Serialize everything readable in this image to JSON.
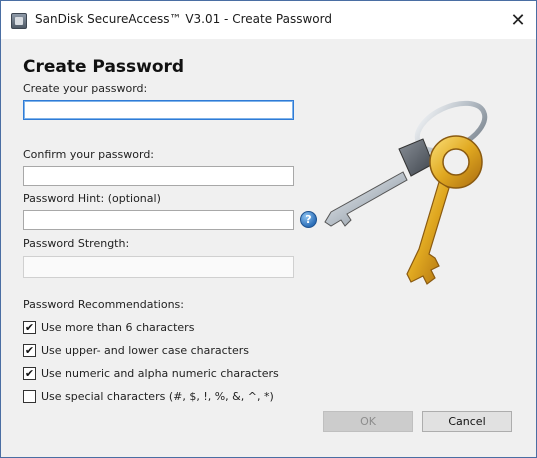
{
  "window": {
    "title": "SanDisk SecureAccess™ V3.01 - Create Password",
    "close_glyph": "✕"
  },
  "form": {
    "heading": "Create Password",
    "create_label": "Create your password:",
    "create_value": "",
    "confirm_label": "Confirm your password:",
    "confirm_value": "",
    "hint_label": "Password Hint: (optional)",
    "hint_value": "",
    "strength_label": "Password Strength:",
    "strength_value": "",
    "help_glyph": "?"
  },
  "recommendations": {
    "label": "Password Recommendations:",
    "items": [
      {
        "label": "Use more than 6 characters",
        "checked": true,
        "mark": "✔"
      },
      {
        "label": "Use upper- and lower case characters",
        "checked": true,
        "mark": "✔"
      },
      {
        "label": "Use numeric and alpha numeric characters",
        "checked": true,
        "mark": "✔"
      },
      {
        "label": "Use special characters (#, $, !, %, &, ^, *)",
        "checked": false,
        "mark": ""
      }
    ]
  },
  "buttons": {
    "ok": "OK",
    "cancel": "Cancel"
  },
  "icons": {
    "app": "sandisk-app-icon",
    "close": "close-icon",
    "help": "help-icon",
    "keys": "keys-illustration"
  }
}
